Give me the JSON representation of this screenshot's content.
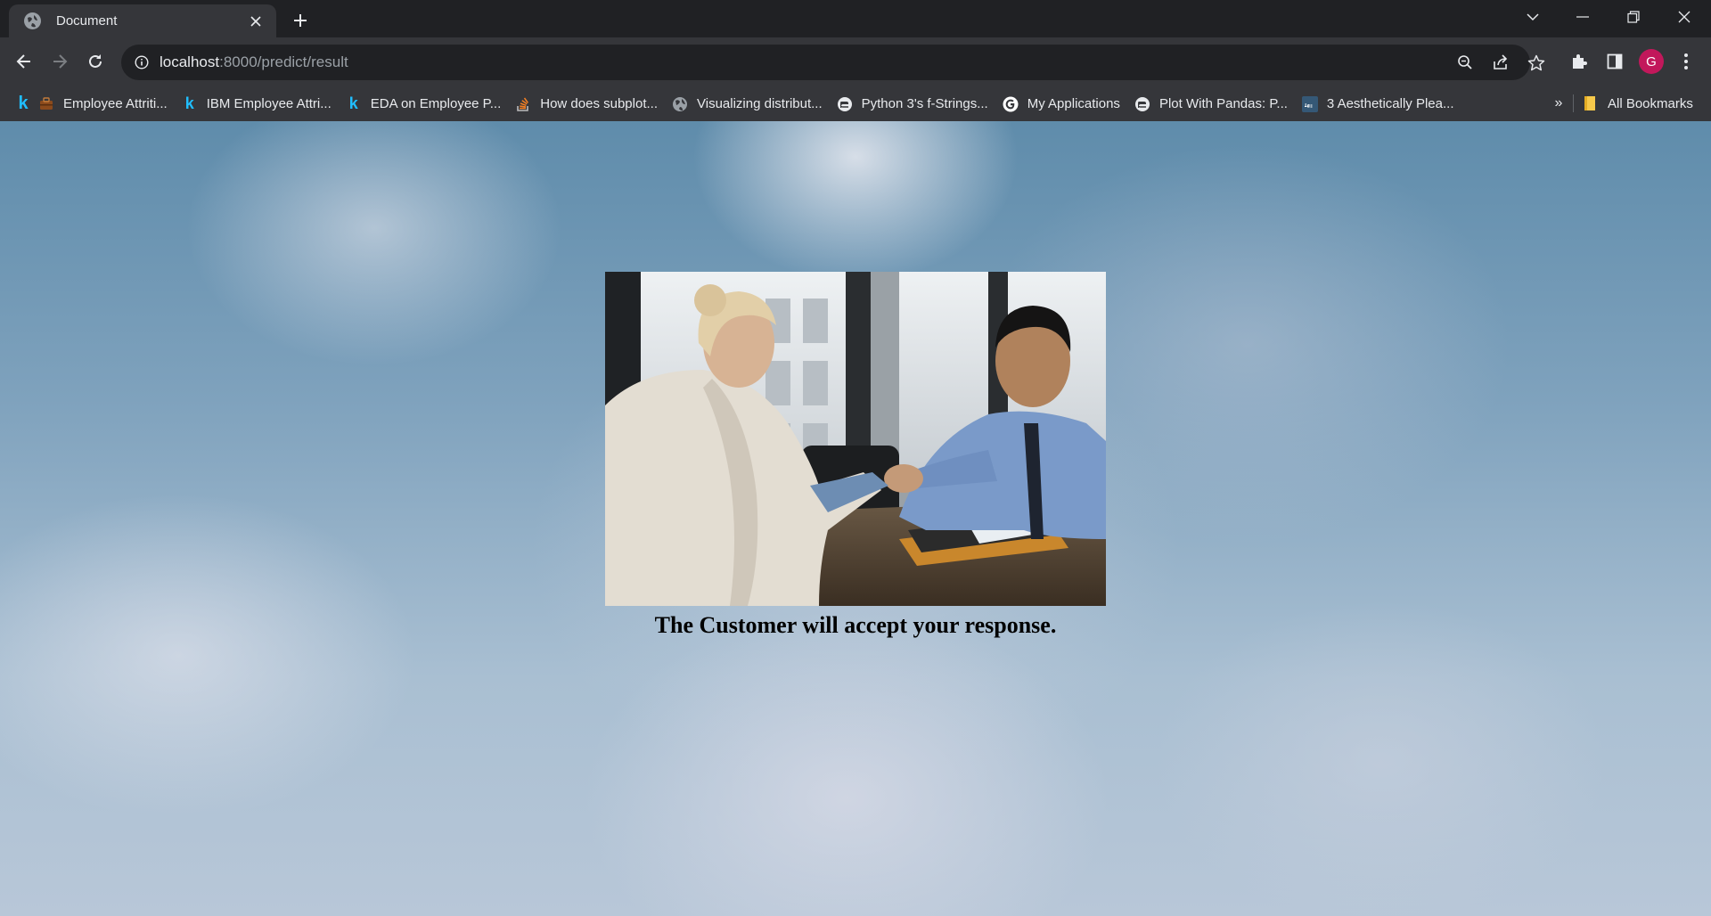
{
  "browser": {
    "tab": {
      "title": "Document"
    },
    "address_bar": {
      "host": "localhost",
      "path": ":8000/predict/result"
    },
    "profile_initial": "G",
    "bookmarks": [
      {
        "label": "Employee Attriti...",
        "icon": "briefcase-icon"
      },
      {
        "label": "IBM Employee Attri...",
        "icon": "kaggle-icon"
      },
      {
        "label": "EDA on Employee P...",
        "icon": "kaggle-icon"
      },
      {
        "label": "How does subplot...",
        "icon": "stackoverflow-icon"
      },
      {
        "label": "Visualizing distribut...",
        "icon": "globe-icon"
      },
      {
        "label": "Python 3's f-Strings...",
        "icon": "realpython-icon"
      },
      {
        "label": "My Applications",
        "icon": "google-icon"
      },
      {
        "label": "Plot With Pandas: P...",
        "icon": "realpython-icon"
      },
      {
        "label": "3 Aesthetically Plea...",
        "icon": "tds-icon"
      }
    ],
    "more_bookmarks_label": "»",
    "all_bookmarks_label": "All Bookmarks"
  },
  "page": {
    "result_message": "The Customer will accept your response."
  },
  "colors": {
    "chrome_dark": "#202124",
    "chrome_toolbar": "#35363a",
    "avatar": "#c2185b",
    "kaggle_blue": "#20beff"
  }
}
